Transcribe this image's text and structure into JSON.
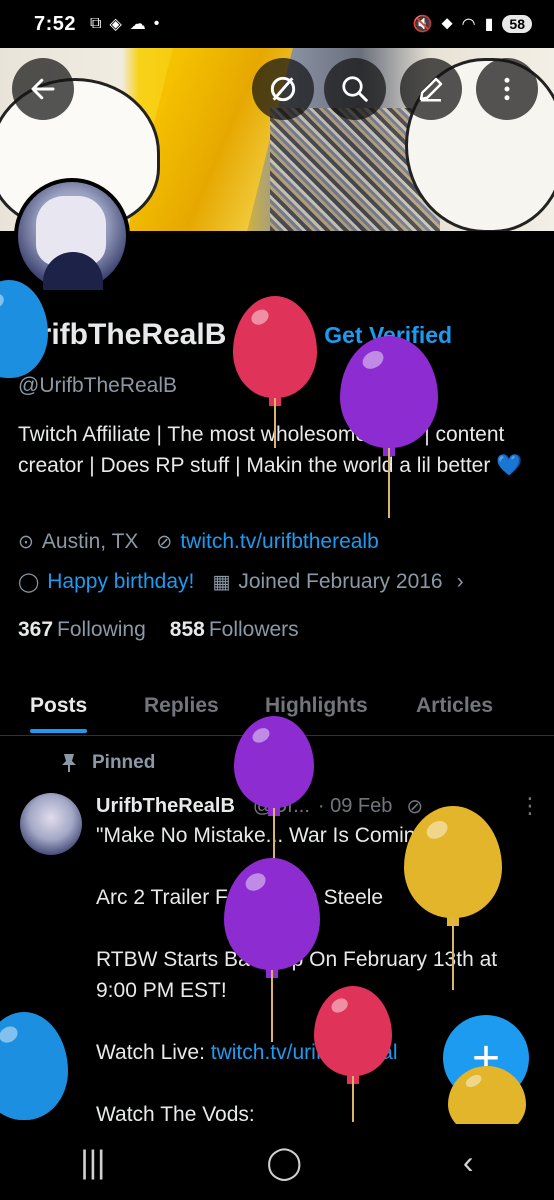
{
  "status_bar": {
    "time": "7:52",
    "battery": "58"
  },
  "profile": {
    "display_name": "UrifbTheRealB",
    "badge_emoji": "🦌",
    "get_verified_label": "Get Verified",
    "handle": "@UrifbTheRealB",
    "bio_line": "Twitch Affiliate | The most wholesome Deer | content creator | Does RP stuff | Makin the world a lil better",
    "bio_emoji": "💙",
    "location": "Austin, TX",
    "website": "twitch.tv/urifbtherealb",
    "birthday": "Happy birthday!",
    "joined": "Joined February 2016",
    "following_count": "367",
    "following_label": "Following",
    "followers_count": "858",
    "followers_label": "Followers"
  },
  "tabs": [
    {
      "label": "Posts",
      "active": true
    },
    {
      "label": "Replies",
      "active": false
    },
    {
      "label": "Highlights",
      "active": false
    },
    {
      "label": "Articles",
      "active": false
    }
  ],
  "pinned_label": "Pinned",
  "post": {
    "author_name": "UrifbTheRealB",
    "author_handle": "@Ur...",
    "date": "· 09 Feb",
    "line1": "\"Make No Mistake... War Is Coming\"",
    "line2": "Arc 2 Trailer For Declan Steele",
    "line3": "RTBW Starts Back Up On February 13th at 9:00 PM EST!",
    "watch_live_label": "Watch Live: ",
    "watch_live_link": "twitch.tv/urifbthereal",
    "line5": "Watch The Vods:"
  },
  "icons": {
    "back": "back-arrow-icon",
    "grok": "grok-icon",
    "search": "search-icon",
    "edit": "edit-icon",
    "more": "more-vertical-icon",
    "location": "location-pin-icon",
    "link": "link-icon",
    "birthday": "balloon-icon",
    "calendar": "calendar-icon",
    "pin": "pin-icon",
    "compose": "plus-icon"
  },
  "colors": {
    "accent": "#1d9bf0",
    "background": "#000000",
    "text_primary": "#e7e9ea",
    "text_secondary": "#8b98a5"
  }
}
